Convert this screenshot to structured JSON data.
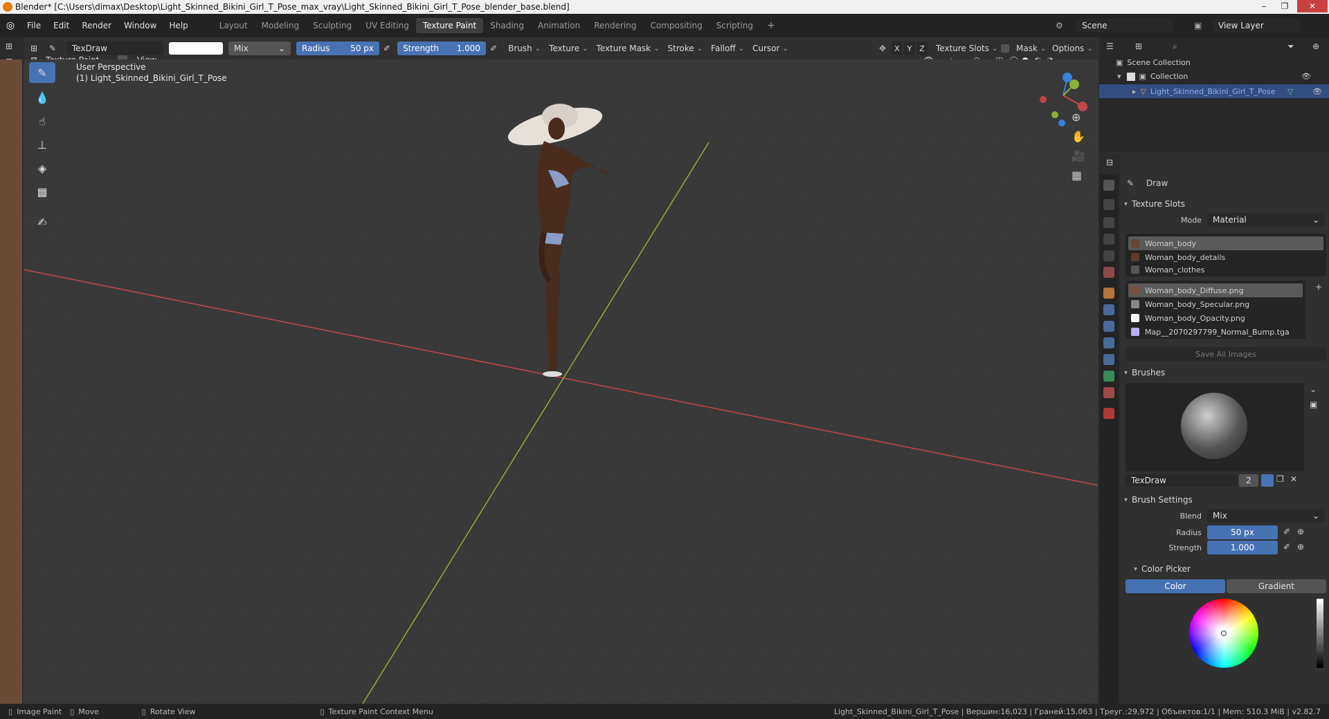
{
  "window": {
    "title": "Blender* [C:\\Users\\dimax\\Desktop\\Light_Skinned_Bikini_Girl_T_Pose_max_vray\\Light_Skinned_Bikini_Girl_T_Pose_blender_base.blend]"
  },
  "menu": [
    "File",
    "Edit",
    "Render",
    "Window",
    "Help"
  ],
  "workspaces": [
    "Layout",
    "Modeling",
    "Sculpting",
    "UV Editing",
    "Texture Paint",
    "Shading",
    "Animation",
    "Rendering",
    "Compositing",
    "Scripting"
  ],
  "active_workspace": "Texture Paint",
  "scene": {
    "label": "Scene",
    "view_layer": "View Layer"
  },
  "tool_header": {
    "brush_name": "TexDraw",
    "blend": "Mix",
    "radius_label": "Radius",
    "radius_value": "50 px",
    "strength_label": "Strength",
    "strength_value": "1.000",
    "menus": [
      "Brush",
      "Texture",
      "Texture Mask",
      "Stroke",
      "Falloff",
      "Cursor"
    ],
    "axes": [
      "X",
      "Y",
      "Z"
    ],
    "right_menus": [
      "Texture Slots",
      "Mask",
      "Options"
    ]
  },
  "mode_header": {
    "mode": "Texture Paint",
    "view": "View"
  },
  "viewport": {
    "perspective": "User Perspective",
    "object": "(1) Light_Skinned_Bikini_Girl_T_Pose"
  },
  "outliner": {
    "root": "Scene Collection",
    "collection": "Collection",
    "object": "Light_Skinned_Bikini_Girl_T_Pose"
  },
  "properties": {
    "tool_name": "Draw",
    "texture_slots": {
      "title": "Texture Slots",
      "mode_label": "Mode",
      "mode_value": "Material",
      "materials": [
        "Woman_body",
        "Woman_body_details",
        "Woman_clothes"
      ],
      "images": [
        "Woman_body_Diffuse.png",
        "Woman_body_Specular.png",
        "Woman_body_Opacity.png",
        "Map__2070297799_Normal_Bump.tga"
      ],
      "save_all": "Save All Images"
    },
    "brushes": {
      "title": "Brushes",
      "name": "TexDraw",
      "users": "2"
    },
    "brush_settings": {
      "title": "Brush Settings",
      "blend_label": "Blend",
      "blend_value": "Mix",
      "radius_label": "Radius",
      "radius_value": "50 px",
      "strength_label": "Strength",
      "strength_value": "1.000"
    },
    "color_picker": {
      "title": "Color Picker",
      "tab_color": "Color",
      "tab_gradient": "Gradient"
    }
  },
  "statusbar": {
    "items": [
      "Image Paint",
      "Move",
      "Rotate View",
      "Texture Paint Context Menu"
    ],
    "stats": "Light_Skinned_Bikini_Girl_T_Pose | Вершин:16,023 | Граней:15,063 | Треуг.:29,972 | Объектов:1/1 | Mem: 510.3 MiB | v2.82.7"
  },
  "colors": {
    "accent": "#4772b3",
    "x_axis": "#c04848",
    "y_axis": "#8db03a",
    "z_axis": "#3a7fd8"
  }
}
